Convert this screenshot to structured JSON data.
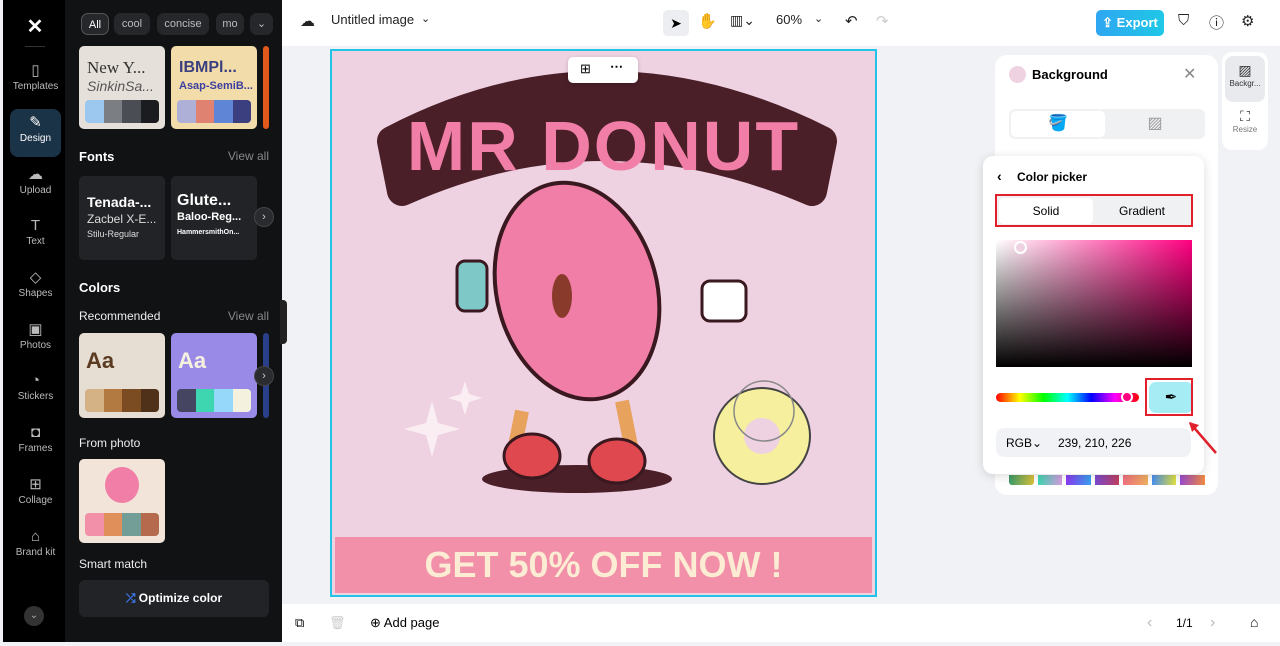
{
  "rail": {
    "items": [
      {
        "label": "Templates",
        "icon": "templates-icon",
        "glyph": "▯"
      },
      {
        "label": "Design",
        "icon": "design-icon",
        "glyph": "✎"
      },
      {
        "label": "Upload",
        "icon": "upload-icon",
        "glyph": "☁"
      },
      {
        "label": "Text",
        "icon": "text-icon",
        "glyph": "T"
      },
      {
        "label": "Shapes",
        "icon": "shapes-icon",
        "glyph": "◇"
      },
      {
        "label": "Photos",
        "icon": "photos-icon",
        "glyph": "▣"
      },
      {
        "label": "Stickers",
        "icon": "stickers-icon",
        "glyph": "◔"
      },
      {
        "label": "Frames",
        "icon": "frames-icon",
        "glyph": "◘"
      },
      {
        "label": "Collage",
        "icon": "collage-icon",
        "glyph": "⊞"
      },
      {
        "label": "Brand kit",
        "icon": "brand-kit-icon",
        "glyph": "⌂"
      }
    ]
  },
  "panel": {
    "chips": [
      "All",
      "cool",
      "concise",
      "mo"
    ],
    "themes": [
      {
        "title": "New Y...",
        "subtitle": "SinkinSa...",
        "colors": [
          "#9cc8ef",
          "#7b7f84",
          "#4a4d53",
          "#1a1c1f"
        ]
      },
      {
        "title": "IBMPl...",
        "subtitle": "Asap-SemiB...",
        "colors": [
          "#aeb0d8",
          "#e08271",
          "#5f86d6",
          "#3c3f7f"
        ]
      }
    ],
    "fonts_heading": "Fonts",
    "view_all": "View all",
    "fonts": [
      {
        "l1": "Tenada-...",
        "l2": "Zacbel X-E...",
        "l3": "Stilu-Regular"
      },
      {
        "l1": "Glute...",
        "l2": "Baloo-Reg...",
        "l3": "HammersmithOn..."
      }
    ],
    "colors_heading": "Colors",
    "recommended": "Recommended",
    "palettes": [
      {
        "sample": "Aa",
        "colors": [
          "#d5b186",
          "#b27a40",
          "#7b4b22",
          "#4f3018"
        ]
      },
      {
        "sample": "Aa",
        "colors": [
          "#464561",
          "#3ed6b0",
          "#96d8fa",
          "#f5f1df"
        ]
      }
    ],
    "from_photo": "From photo",
    "photo_colors": [
      "#f28fa9",
      "#e08e5a",
      "#739d97",
      "#b56a4d"
    ],
    "smart_match": "Smart match",
    "optimize": "Optimize color"
  },
  "topbar": {
    "title": "Untitled image",
    "zoom": "60%",
    "export": "Export"
  },
  "canvas": {
    "headline": "MR DONUT",
    "banner": "GET 50% OFF NOW !",
    "bg": "#efd2e2"
  },
  "bottombar": {
    "add_page": "Add page",
    "page": "1/1"
  },
  "background_panel": {
    "title": "Background",
    "swatch": "#efd2e2"
  },
  "right_rail": {
    "background": "Backgr...",
    "resize": "Resize"
  },
  "picker": {
    "title": "Color picker",
    "tabs": [
      "Solid",
      "Gradient"
    ],
    "mode": "RGB",
    "value": "239, 210, 226",
    "hue_color": "#ff0080"
  },
  "accent": "#22c3e6"
}
